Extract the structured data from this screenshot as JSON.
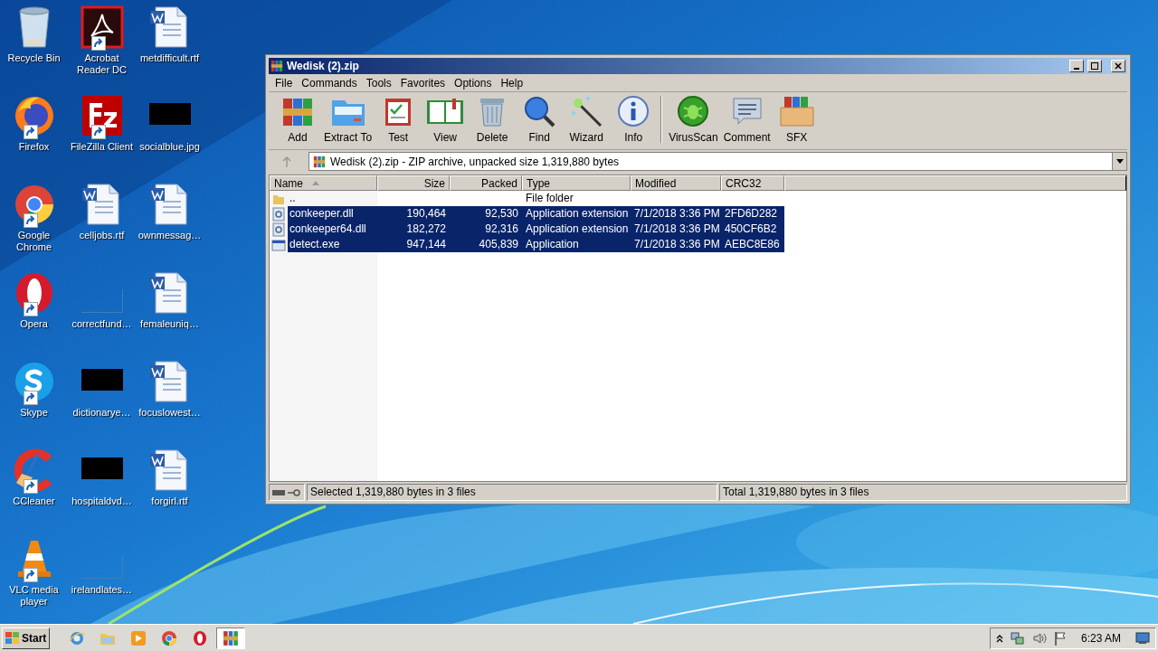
{
  "desktop_icons": [
    {
      "label": "Recycle Bin",
      "kind": "recycle",
      "shortcut": false
    },
    {
      "label": "Firefox",
      "kind": "firefox",
      "shortcut": true
    },
    {
      "label": "Google Chrome",
      "kind": "chrome",
      "shortcut": true
    },
    {
      "label": "Opera",
      "kind": "opera",
      "shortcut": true
    },
    {
      "label": "Skype",
      "kind": "skype",
      "shortcut": true
    },
    {
      "label": "CCleaner",
      "kind": "ccleaner",
      "shortcut": true
    },
    {
      "label": "VLC media player",
      "kind": "vlc",
      "shortcut": true
    },
    {
      "label": "Acrobat Reader DC",
      "kind": "acrobat",
      "shortcut": true
    },
    {
      "label": "FileZilla Client",
      "kind": "filezilla",
      "shortcut": true
    },
    {
      "label": "celljobs.rtf",
      "kind": "word",
      "shortcut": false
    },
    {
      "label": "correctfund…",
      "kind": "blank",
      "shortcut": false
    },
    {
      "label": "dictionarye…",
      "kind": "black",
      "shortcut": false
    },
    {
      "label": "hospitaldvd…",
      "kind": "black",
      "shortcut": false
    },
    {
      "label": "irelandlates…",
      "kind": "blank",
      "shortcut": false
    },
    {
      "label": "metdifficult.rtf",
      "kind": "word",
      "shortcut": false
    },
    {
      "label": "socialblue.jpg",
      "kind": "black",
      "shortcut": false
    },
    {
      "label": "ownmessag…",
      "kind": "word",
      "shortcut": false
    },
    {
      "label": "femaleuniq…",
      "kind": "word",
      "shortcut": false
    },
    {
      "label": "focuslowest…",
      "kind": "word",
      "shortcut": false
    },
    {
      "label": "forgirl.rtf",
      "kind": "word",
      "shortcut": false
    }
  ],
  "window": {
    "title": "Wedisk (2).zip",
    "menu": [
      "File",
      "Commands",
      "Tools",
      "Favorites",
      "Options",
      "Help"
    ],
    "toolbar": [
      {
        "label": "Add",
        "kind": "add"
      },
      {
        "label": "Extract To",
        "kind": "extract"
      },
      {
        "label": "Test",
        "kind": "test"
      },
      {
        "label": "View",
        "kind": "view"
      },
      {
        "label": "Delete",
        "kind": "delete"
      },
      {
        "label": "Find",
        "kind": "find"
      },
      {
        "label": "Wizard",
        "kind": "wizard"
      },
      {
        "label": "Info",
        "kind": "info"
      },
      {
        "label": "VirusScan",
        "kind": "virus"
      },
      {
        "label": "Comment",
        "kind": "comment"
      },
      {
        "label": "SFX",
        "kind": "sfx"
      }
    ],
    "address": "Wedisk (2).zip - ZIP archive, unpacked size 1,319,880 bytes",
    "columns": [
      "Name",
      "Size",
      "Packed",
      "Type",
      "Modified",
      "CRC32"
    ],
    "rows": [
      {
        "kind": "folder",
        "name": "..",
        "type": "File folder",
        "selected": false
      },
      {
        "kind": "dll",
        "name": "conkeeper.dll",
        "size": "190,464",
        "packed": "92,530",
        "type": "Application extension",
        "modified": "7/1/2018 3:36 PM",
        "crc": "2FD6D282",
        "selected": true
      },
      {
        "kind": "dll",
        "name": "conkeeper64.dll",
        "size": "182,272",
        "packed": "92,316",
        "type": "Application extension",
        "modified": "7/1/2018 3:36 PM",
        "crc": "450CF6B2",
        "selected": true
      },
      {
        "kind": "exe",
        "name": "detect.exe",
        "size": "947,144",
        "packed": "405,839",
        "type": "Application",
        "modified": "7/1/2018 3:36 PM",
        "crc": "AEBC8E86",
        "selected": true
      }
    ],
    "status": {
      "left": "Selected 1,319,880 bytes in 3 files",
      "right": "Total 1,319,880 bytes in 3 files"
    }
  },
  "taskbar": {
    "start": "Start",
    "apps": [
      {
        "kind": "ie",
        "active": false
      },
      {
        "kind": "explorer",
        "active": false
      },
      {
        "kind": "media",
        "active": false
      },
      {
        "kind": "chrome",
        "active": false
      },
      {
        "kind": "opera",
        "active": false
      },
      {
        "kind": "winrar",
        "active": true
      }
    ],
    "clock": "6:23 AM"
  }
}
